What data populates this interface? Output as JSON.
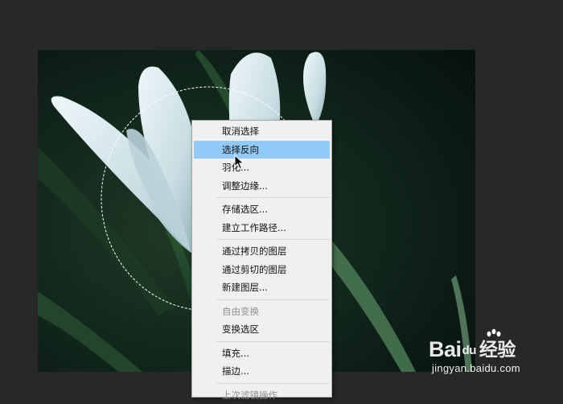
{
  "context_menu": {
    "groups": [
      [
        {
          "label": "取消选择",
          "state": "normal"
        },
        {
          "label": "选择反向",
          "state": "selected"
        },
        {
          "label": "羽化...",
          "state": "normal"
        },
        {
          "label": "调整边缘...",
          "state": "normal"
        }
      ],
      [
        {
          "label": "存储选区...",
          "state": "normal"
        },
        {
          "label": "建立工作路径...",
          "state": "normal"
        }
      ],
      [
        {
          "label": "通过拷贝的图层",
          "state": "normal"
        },
        {
          "label": "通过剪切的图层",
          "state": "normal"
        },
        {
          "label": "新建图层...",
          "state": "normal"
        }
      ],
      [
        {
          "label": "自由变换",
          "state": "disabled"
        },
        {
          "label": "变换选区",
          "state": "normal"
        }
      ],
      [
        {
          "label": "填充...",
          "state": "normal"
        },
        {
          "label": "描边...",
          "state": "normal"
        }
      ],
      [
        {
          "label": "上次滤镜操作",
          "state": "disabled"
        }
      ]
    ]
  },
  "canvas": {
    "subject": "white flower petals on dark green background",
    "selection": "elliptical marquee (marching ants)"
  },
  "watermark": {
    "brand_a": "Bai",
    "brand_du": "du",
    "brand_cn": "经验",
    "url": "jingyan.baidu.com"
  },
  "colors": {
    "workspace": "#282828",
    "menu_bg": "#f0f0f0",
    "menu_highlight": "#91c9f7",
    "disabled_text": "#8f8f8f"
  }
}
